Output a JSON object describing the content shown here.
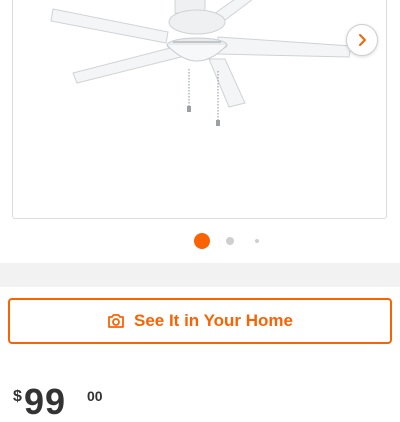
{
  "gallery": {
    "image_alt": "White ceiling fan with light kit",
    "next_icon": "chevron-right-icon",
    "dots_count": 3,
    "active_dot": 1
  },
  "ar_button": {
    "label": "See It in Your Home",
    "icon": "camera-icon"
  },
  "price": {
    "currency": "$",
    "dollars": "99",
    "cents": "00"
  },
  "colors": {
    "accent": "#f96302",
    "dot_inactive": "#cfcfcf",
    "band": "#f2f2f2",
    "frame_border": "#dcdcdc"
  }
}
